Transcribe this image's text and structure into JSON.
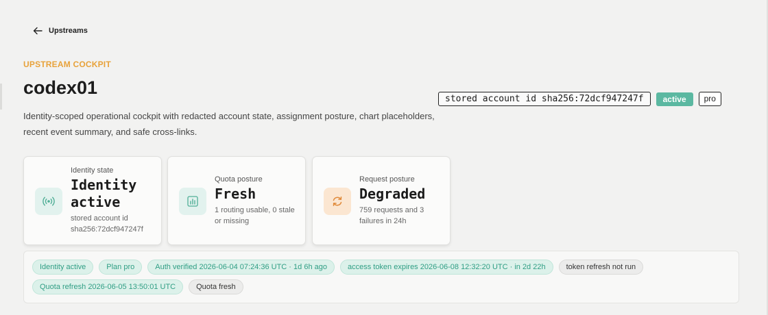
{
  "nav": {
    "back_label": "Upstreams"
  },
  "header": {
    "eyebrow": "UPSTREAM COCKPIT",
    "title": "codex01",
    "description": "Identity-scoped operational cockpit with redacted account state, assignment posture, chart placeholders, recent event summary, and safe cross-links.",
    "account_id_chip": "stored account id sha256:72dcf947247f",
    "status_chip": "active",
    "plan_chip": "pro"
  },
  "cards": [
    {
      "icon": "radio-signal-icon",
      "label": "Identity state",
      "value": "Identity active",
      "sub": "stored account id sha256:72dcf947247f"
    },
    {
      "icon": "bar-chart-icon",
      "label": "Quota posture",
      "value": "Fresh",
      "sub": "1 routing usable, 0 stale or missing"
    },
    {
      "icon": "refresh-icon",
      "label": "Request posture",
      "value": "Degraded",
      "sub": "759 requests and 3 failures in 24h"
    }
  ],
  "tags": {
    "row1": [
      {
        "text": "Identity active",
        "tone": "teal"
      },
      {
        "text": "Plan pro",
        "tone": "teal"
      },
      {
        "text": "Auth verified 2026-06-04 07:24:36 UTC · 1d 6h ago",
        "tone": "teal"
      },
      {
        "text": "access token expires 2026-06-08 12:32:20 UTC · in 2d 22h",
        "tone": "teal"
      },
      {
        "text": "token refresh not run",
        "tone": "grey"
      }
    ],
    "row2": [
      {
        "text": "Quota refresh 2026-06-05 13:50:01 UTC",
        "tone": "teal"
      },
      {
        "text": "Quota fresh",
        "tone": "grey"
      }
    ]
  },
  "colors": {
    "accent": "#e8a23a",
    "status_active": "#5bb8a1",
    "tag_teal_text": "#2f9e84",
    "degraded_icon": "#e08a3a"
  }
}
